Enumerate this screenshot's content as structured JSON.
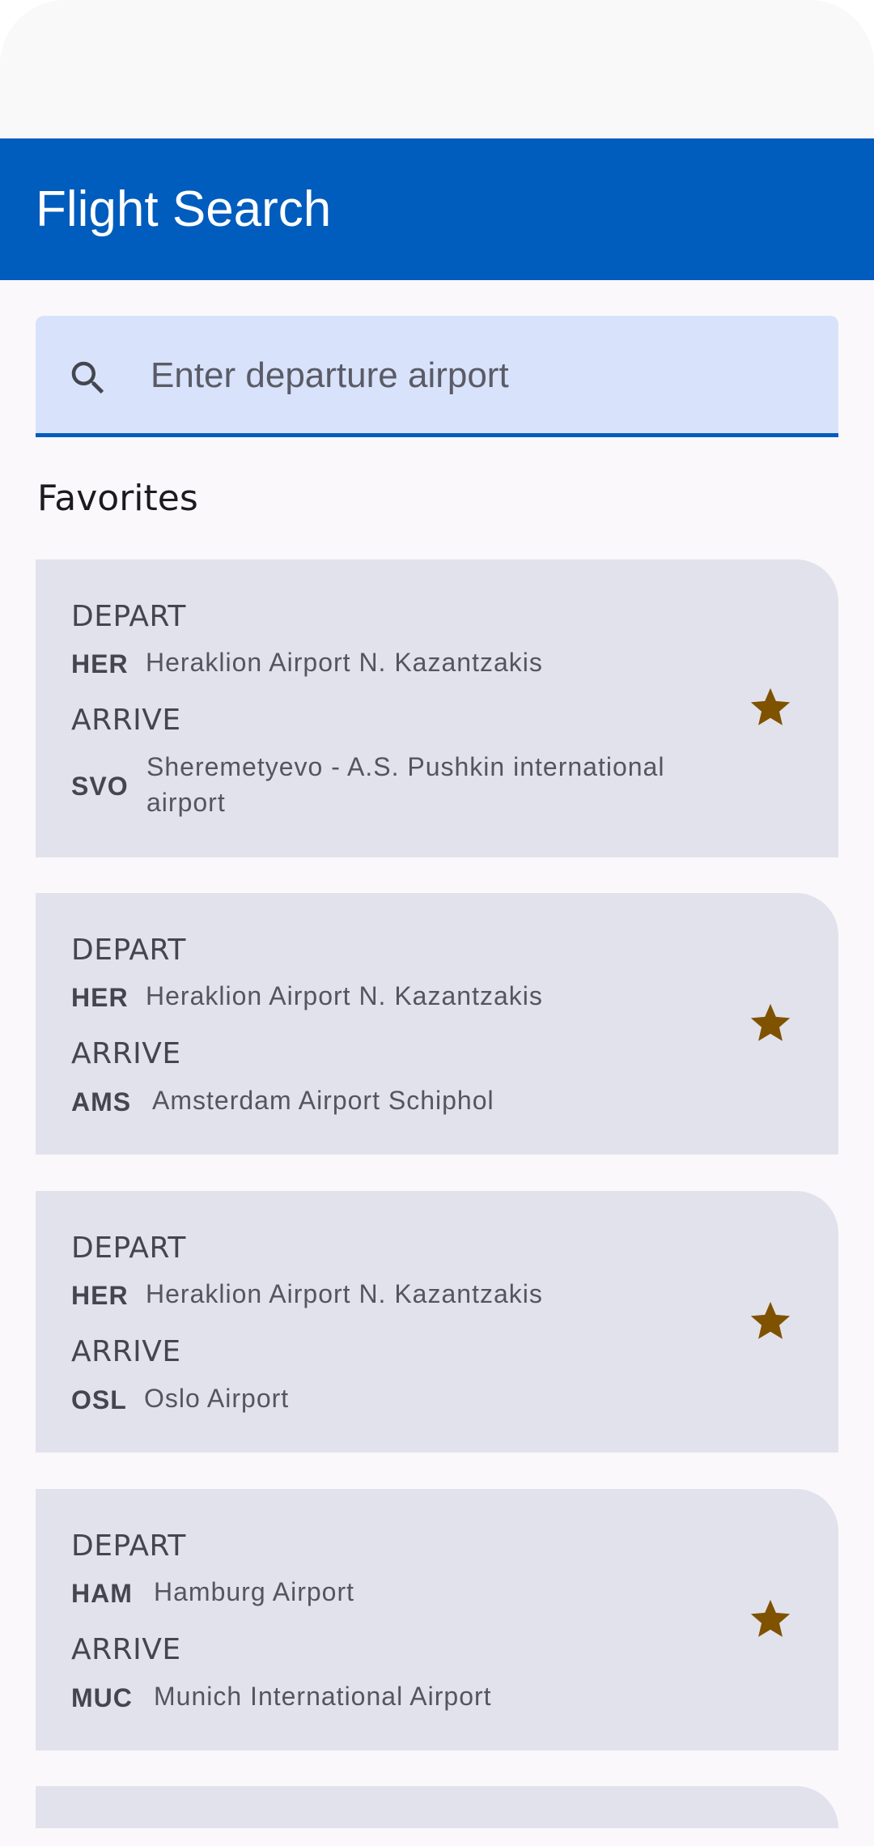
{
  "app_bar": {
    "title": "Flight Search"
  },
  "search": {
    "placeholder": "Enter departure airport",
    "value": ""
  },
  "favorites": {
    "title": "Favorites",
    "depart_label": "DEPART",
    "arrive_label": "ARRIVE",
    "items": [
      {
        "depart_code": "HER",
        "depart_name": "Heraklion Airport N. Kazantzakis",
        "arrive_code": "SVO",
        "arrive_name": "Sheremetyevo - A.S. Pushkin international airport",
        "favorite": true
      },
      {
        "depart_code": "HER",
        "depart_name": "Heraklion Airport N. Kazantzakis",
        "arrive_code": "AMS",
        "arrive_name": "Amsterdam Airport Schiphol",
        "favorite": true
      },
      {
        "depart_code": "HER",
        "depart_name": "Heraklion Airport N. Kazantzakis",
        "arrive_code": "OSL",
        "arrive_name": "Oslo Airport",
        "favorite": true
      },
      {
        "depart_code": "HAM",
        "depart_name": "Hamburg Airport",
        "arrive_code": "MUC",
        "arrive_name": "Munich International Airport",
        "favorite": true
      }
    ]
  },
  "colors": {
    "primary": "#005cbd",
    "search_container": "#d8e2fb",
    "card_background": "#e2e2ec",
    "star": "#7f5200"
  },
  "icons": {
    "search": "search-icon",
    "favorite": "star-icon"
  }
}
